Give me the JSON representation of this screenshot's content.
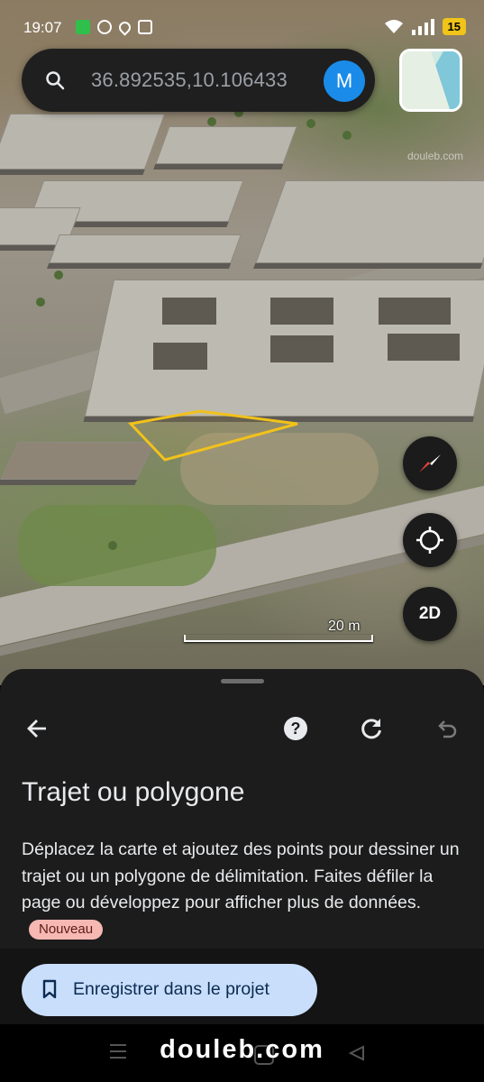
{
  "status_bar": {
    "time": "19:07",
    "battery": "15"
  },
  "search": {
    "coordinates": "36.892535,10.106433",
    "avatar_letter": "M"
  },
  "map": {
    "watermark": "douleb.com",
    "scale_label": "20 m",
    "mode_button": "2D",
    "polygon_color": "#f2c21b"
  },
  "sheet": {
    "title": "Trajet ou polygone",
    "description": "Déplacez la carte et ajoutez des points pour dessiner un trajet ou un polygone de délimitation. Faites défiler la page ou développez pour afficher plus de données.",
    "badge": "Nouveau",
    "save_button": "Enregistrer dans le projet"
  },
  "footer": {
    "watermark": "douleb.com"
  },
  "icons": [
    "search-icon",
    "back-arrow-icon",
    "help-icon",
    "refresh-icon",
    "undo-icon",
    "bookmark-icon",
    "compass-icon",
    "locate-icon",
    "wifi-icon",
    "signal-icon"
  ]
}
